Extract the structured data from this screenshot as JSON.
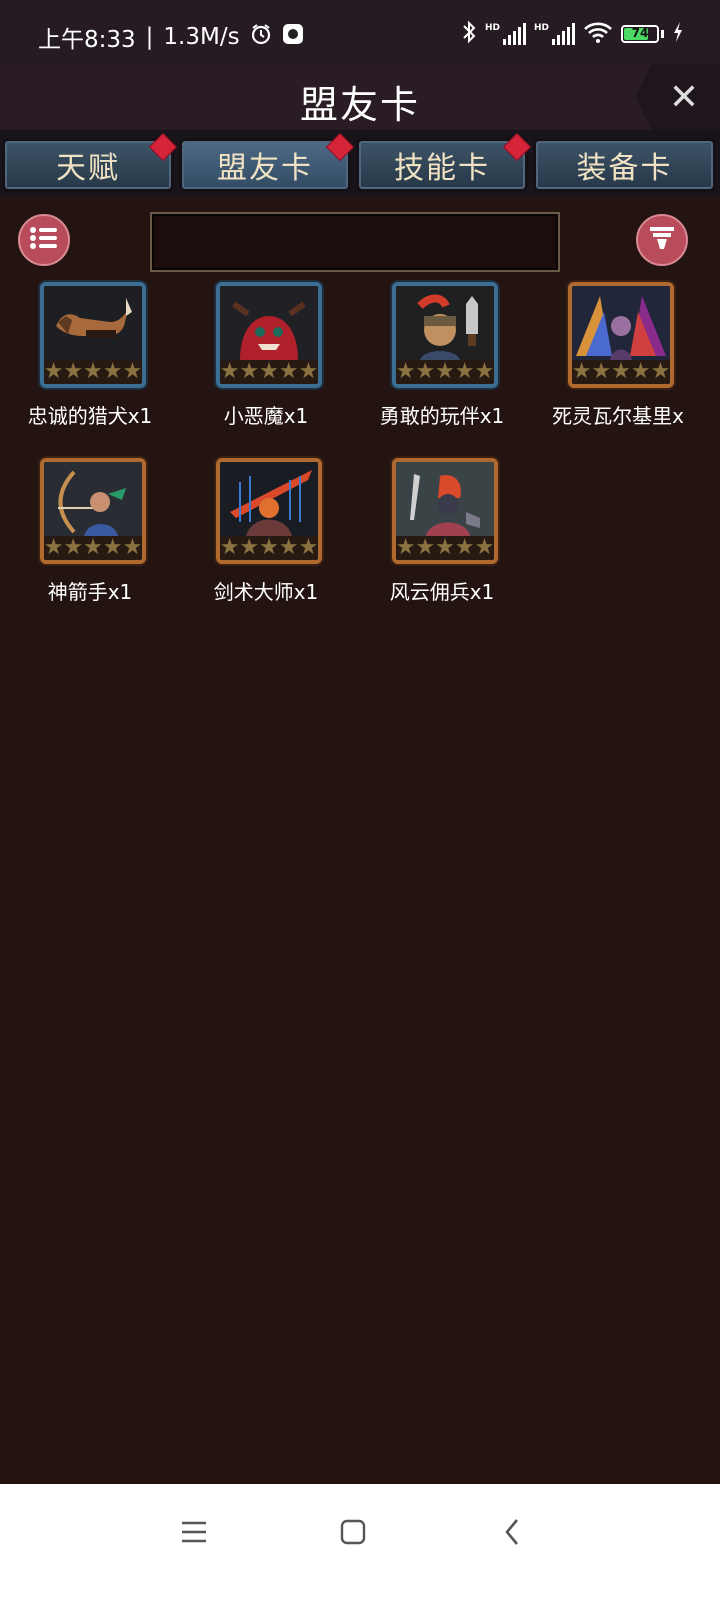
{
  "status_bar": {
    "time": "上午8:33",
    "speed": "1.3M/s",
    "battery": "74",
    "icons": [
      "alarm-icon",
      "app-icon",
      "bluetooth-icon",
      "signal-hd-icon",
      "signal-hd-icon",
      "wifi-icon",
      "battery-icon",
      "charging-icon"
    ]
  },
  "header": {
    "title": "盟友卡",
    "close_icon": "close-icon"
  },
  "tabs": [
    {
      "label": "天赋",
      "badge": true
    },
    {
      "label": "盟友卡",
      "badge": true,
      "active": true
    },
    {
      "label": "技能卡",
      "badge": true
    },
    {
      "label": "装备卡",
      "badge": false
    }
  ],
  "toolbar": {
    "list_icon": "list-icon",
    "filter_icon": "filter-icon",
    "search_value": ""
  },
  "cards": [
    {
      "name": "忠诚的猎犬x1",
      "stars": 5,
      "frame": "blue",
      "icon": "hound-portrait"
    },
    {
      "name": "小恶魔x1",
      "stars": 5,
      "frame": "blue",
      "icon": "imp-portrait"
    },
    {
      "name": "勇敢的玩伴x1",
      "stars": 5,
      "frame": "blue",
      "icon": "companion-portrait"
    },
    {
      "name": "死灵瓦尔基里x",
      "stars": 5,
      "frame": "orange",
      "icon": "valkyrie-portrait"
    },
    {
      "name": "神箭手x1",
      "stars": 5,
      "frame": "orange",
      "icon": "archer-portrait"
    },
    {
      "name": "剑术大师x1",
      "stars": 5,
      "frame": "orange",
      "icon": "swordmaster-portrait"
    },
    {
      "name": "风云佣兵x1",
      "stars": 5,
      "frame": "orange",
      "icon": "mercenary-portrait"
    }
  ],
  "nav_bar": {
    "icons": [
      "menu-icon",
      "home-icon",
      "back-icon"
    ]
  }
}
